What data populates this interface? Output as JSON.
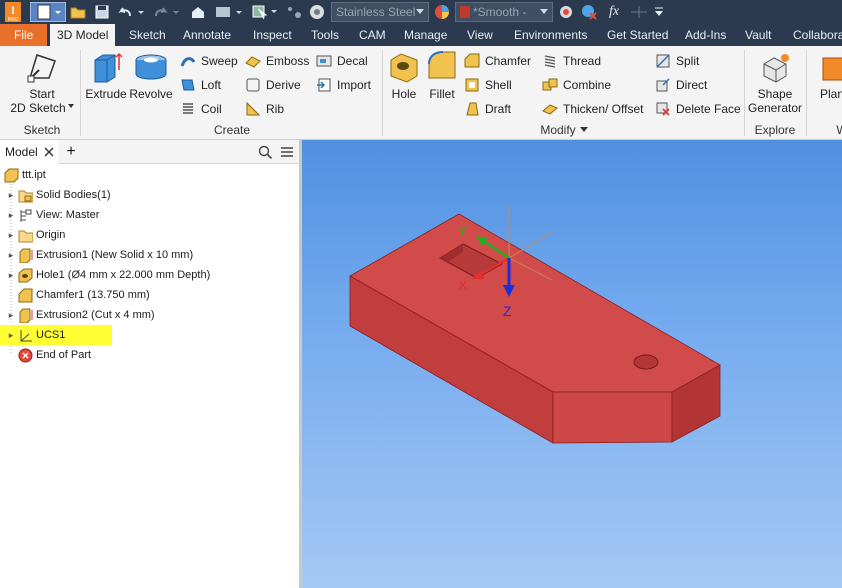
{
  "quick_access": {
    "material": "Stainless Steel",
    "appearance": "*Smooth -",
    "fx": "fx"
  },
  "tabs": [
    {
      "label": "File"
    },
    {
      "label": "3D Model"
    },
    {
      "label": "Sketch"
    },
    {
      "label": "Annotate"
    },
    {
      "label": "Inspect"
    },
    {
      "label": "Tools"
    },
    {
      "label": "CAM"
    },
    {
      "label": "Manage"
    },
    {
      "label": "View"
    },
    {
      "label": "Environments"
    },
    {
      "label": "Get Started"
    },
    {
      "label": "Add-Ins"
    },
    {
      "label": "Vault"
    },
    {
      "label": "Collabora"
    }
  ],
  "ribbon": {
    "sketch": {
      "start_line1": "Start",
      "start_line2": "2D Sketch",
      "panel": "Sketch"
    },
    "create": {
      "extrude": "Extrude",
      "revolve": "Revolve",
      "sweep": "Sweep",
      "loft": "Loft",
      "coil": "Coil",
      "emboss": "Emboss",
      "derive": "Derive",
      "rib": "Rib",
      "decal": "Decal",
      "import": "Import",
      "panel": "Create"
    },
    "modify": {
      "hole": "Hole",
      "fillet": "Fillet",
      "chamfer": "Chamfer",
      "shell": "Shell",
      "draft": "Draft",
      "thread": "Thread",
      "combine": "Combine",
      "thicken": "Thicken/ Offset",
      "split": "Split",
      "direct": "Direct",
      "delete_face": "Delete Face",
      "panel": "Modify"
    },
    "explore": {
      "shape_line1": "Shape",
      "shape_line2": "Generator",
      "panel": "Explore"
    },
    "work": {
      "plane": "Plan",
      "panel": "W"
    }
  },
  "browser": {
    "tab_label": "Model",
    "add": "+",
    "items": [
      {
        "label": "ttt.ipt"
      },
      {
        "label": "Solid Bodies(1)"
      },
      {
        "label": "View: Master"
      },
      {
        "label": "Origin"
      },
      {
        "label": "Extrusion1 (New Solid x 10 mm)"
      },
      {
        "label": "Hole1 (Ø4 mm x 22.000 mm Depth)"
      },
      {
        "label": "Chamfer1 (13.750 mm)"
      },
      {
        "label": "Extrusion2 (Cut x 4 mm)"
      },
      {
        "label": "UCS1"
      },
      {
        "label": "End of Part"
      }
    ]
  },
  "viewport": {
    "axis_x": "X",
    "axis_y": "Y",
    "axis_z": "Z",
    "part_color": "#d04848"
  },
  "colors": {
    "accent": "#e8702a",
    "highlight": "#ffff33",
    "chrome": "#2b3a4e"
  }
}
